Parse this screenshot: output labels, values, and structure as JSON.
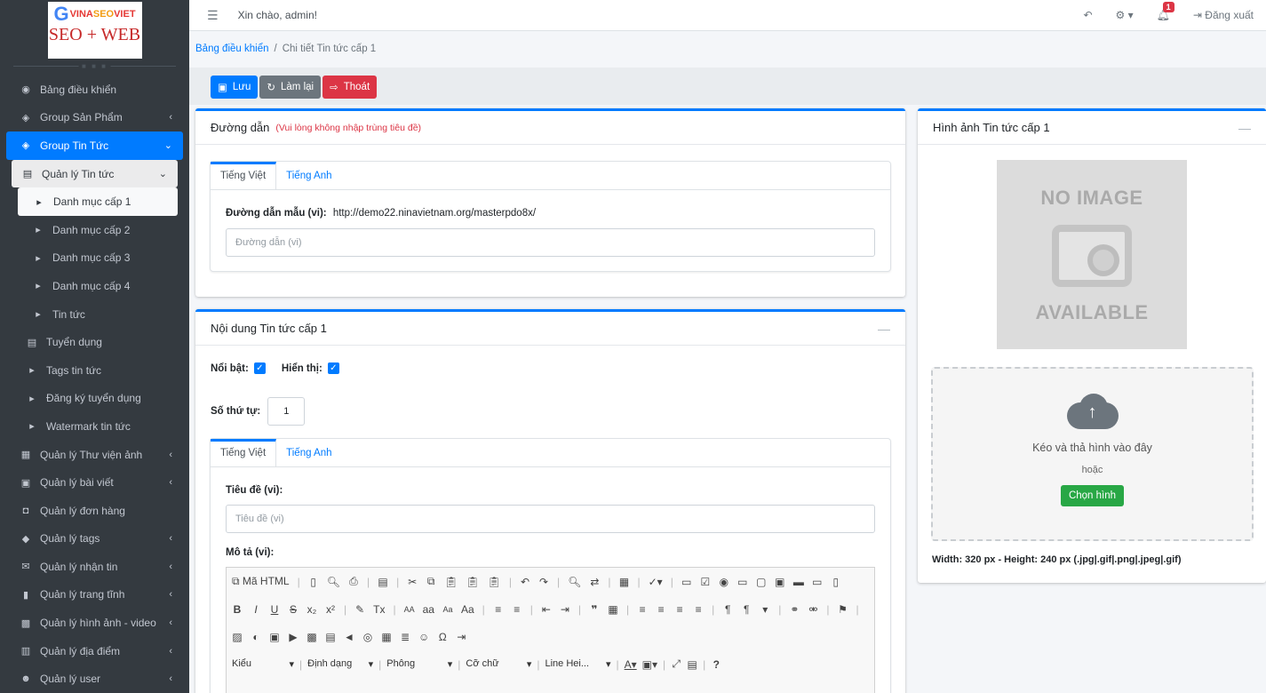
{
  "logo": {
    "g": "G",
    "vina": "VINA",
    "seo": "SEO",
    "viet": "VIET",
    "sub": "SEO + WEB"
  },
  "sidebar": {
    "items": [
      {
        "label": "Bảng điều khiển",
        "icon": "dashboard-icon"
      },
      {
        "label": "Group Sản Phẩm",
        "icon": "layers-icon"
      },
      {
        "label": "Group Tin Tức",
        "icon": "layers-icon"
      },
      {
        "label": "Quản lý Tin tức",
        "icon": "book-icon"
      },
      {
        "label": "Danh mục cấp 1",
        "icon": "caret-square-icon"
      },
      {
        "label": "Danh mục cấp 2",
        "icon": "caret-square-icon"
      },
      {
        "label": "Danh mục cấp 3",
        "icon": "caret-square-icon"
      },
      {
        "label": "Danh mục cấp 4",
        "icon": "caret-square-icon"
      },
      {
        "label": "Tin tức",
        "icon": "caret-square-icon"
      },
      {
        "label": "Tuyển dụng",
        "icon": "book-icon"
      },
      {
        "label": "Tags tin tức",
        "icon": "caret-square-icon"
      },
      {
        "label": "Đăng ký tuyển dụng",
        "icon": "caret-square-icon"
      },
      {
        "label": "Watermark tin tức",
        "icon": "caret-square-icon"
      },
      {
        "label": "Quản lý Thư viện ảnh",
        "icon": "boxes-icon"
      },
      {
        "label": "Quản lý bài viết",
        "icon": "newspaper-icon"
      },
      {
        "label": "Quản lý đơn hàng",
        "icon": "bag-icon"
      },
      {
        "label": "Quản lý tags",
        "icon": "tags-icon"
      },
      {
        "label": "Quản lý nhận tin",
        "icon": "envelope-icon"
      },
      {
        "label": "Quản lý trang tĩnh",
        "icon": "bookmark-icon"
      },
      {
        "label": "Quản lý hình ảnh - video",
        "icon": "photo-video-icon"
      },
      {
        "label": "Quản lý địa điểm",
        "icon": "building-icon"
      },
      {
        "label": "Quản lý user",
        "icon": "users-icon"
      }
    ]
  },
  "topbar": {
    "greeting": "Xin chào, admin!",
    "notif_count": "1",
    "logout": "Đăng xuất"
  },
  "breadcrumb": {
    "home": "Bảng điều khiển",
    "sep": "/",
    "current": "Chi tiết Tin tức cấp 1"
  },
  "actions": {
    "save": "Lưu",
    "reset": "Làm lại",
    "exit": "Thoát"
  },
  "path_card": {
    "title": "Đường dẫn",
    "note": "(Vui lòng không nhập trùng tiêu đề)",
    "tab_vi": "Tiếng Việt",
    "tab_en": "Tiếng Anh",
    "sample_label": "Đường dẫn mẫu (vi):",
    "sample_url": "http://demo22.ninavietnam.org/masterpdo8x/",
    "placeholder": "Đường dẫn (vi)"
  },
  "content_card": {
    "title": "Nội dung Tin tức cấp 1",
    "collapse": "—",
    "featured_label": "Nổi bật:",
    "visible_label": "Hiển thị:",
    "order_label": "Số thứ tự:",
    "order_value": "1",
    "tab_vi": "Tiếng Việt",
    "tab_en": "Tiếng Anh",
    "title_label": "Tiêu đề (vi):",
    "title_placeholder": "Tiêu đề (vi)",
    "desc_label": "Mô tả (vi):"
  },
  "editor": {
    "source": "Mã HTML",
    "styles": "Kiểu",
    "format": "Định dạng",
    "font": "Phông",
    "size": "Cỡ chữ",
    "line_height": "Line Hei..."
  },
  "image_card": {
    "title": "Hình ảnh Tin tức cấp 1",
    "collapse": "—",
    "noimg_top": "NO IMAGE",
    "noimg_bottom": "AVAILABLE",
    "drop_text": "Kéo và thả hình vào đây",
    "or": "hoặc",
    "choose": "Chọn hình",
    "size_note": "Width: 320 px - Height: 240 px (.jpg|.gif|.png|.jpeg|.gif)"
  },
  "colors": {
    "primary": "#007bff",
    "danger": "#dc3545",
    "success": "#28a745",
    "sidebar": "#343a40"
  }
}
